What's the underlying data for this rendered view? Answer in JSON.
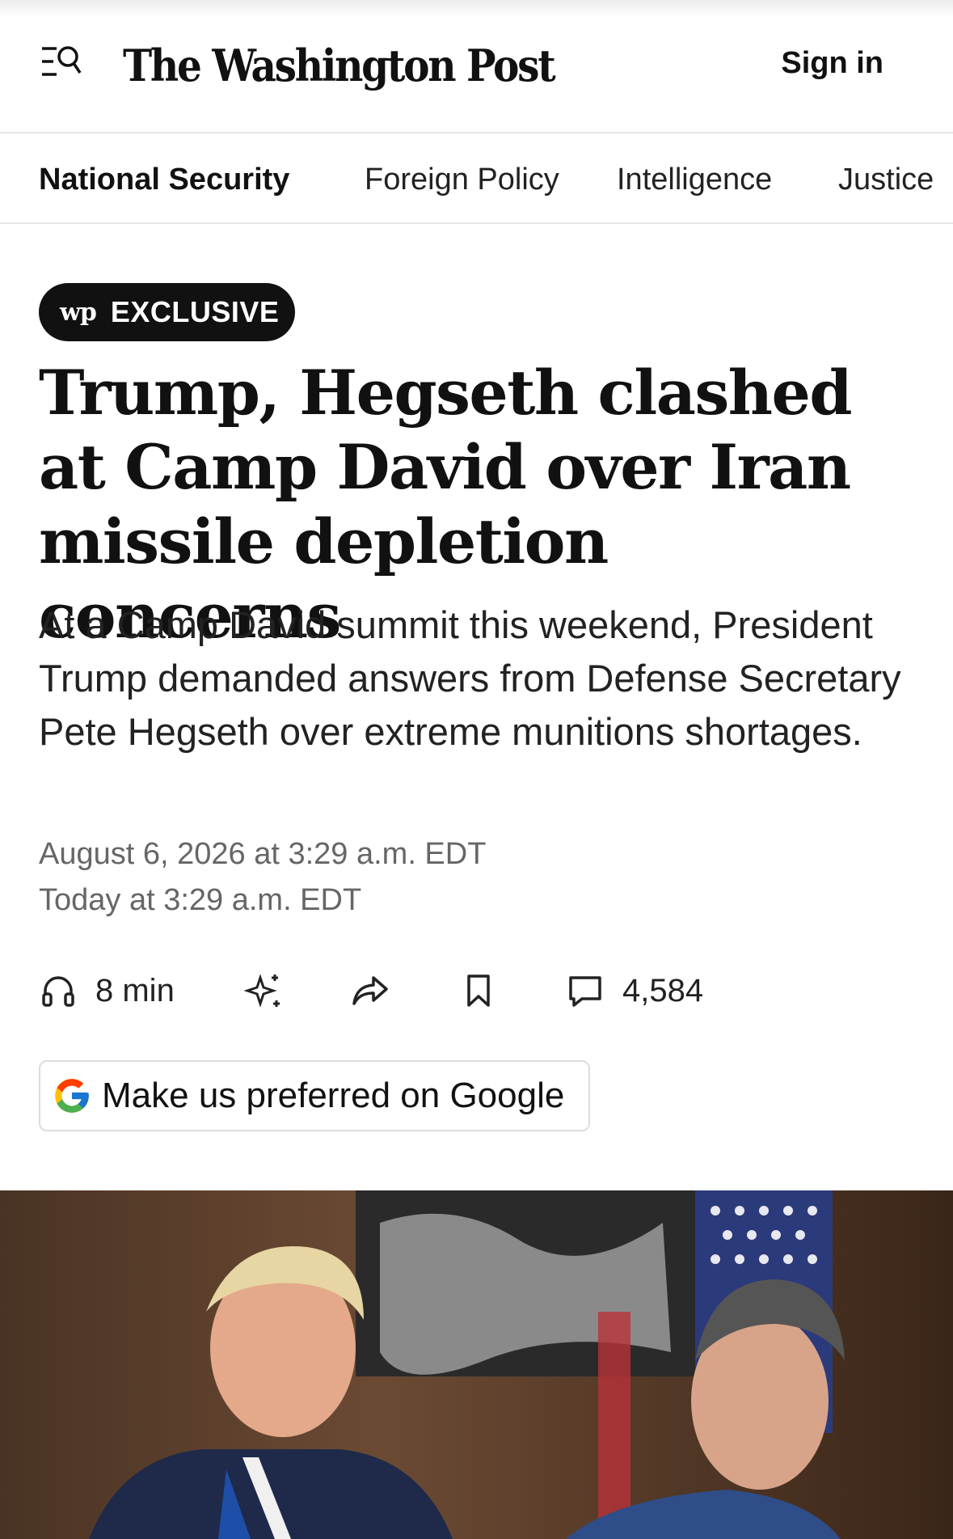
{
  "header": {
    "masthead": "The Washington Post",
    "sign_in": "Sign in"
  },
  "section_nav": {
    "items": [
      {
        "label": "National Security",
        "active": true
      },
      {
        "label": "Foreign Policy",
        "active": false
      },
      {
        "label": "Intelligence",
        "active": false
      },
      {
        "label": "Justice",
        "active": false
      }
    ]
  },
  "article": {
    "badge_logo": "wp",
    "badge_label": "EXCLUSIVE",
    "headline": "Trump, Hegseth clashed at Camp David over Iran missile depletion concerns",
    "dek": "At a Camp David summit this weekend, President Trump demanded answers from Defense Secretary Pete Hegseth over extreme munitions shortages.",
    "published": "August 6, 2026 at 3:29 a.m. EDT",
    "updated": "Today at 3:29 a.m. EDT"
  },
  "actions": {
    "listen_label": "8 min",
    "listen_icon": "headphones-icon",
    "ai_icon": "sparkle-icon",
    "share_icon": "share-icon",
    "save_icon": "bookmark-icon",
    "comments_icon": "comment-icon",
    "comments_count": "4,584"
  },
  "google_button": {
    "label": "Make us preferred on Google",
    "icon": "google-g-icon"
  },
  "colors": {
    "text": "#111111",
    "muted": "#666666",
    "badge_bg": "#111111",
    "divider": "#e6e6e6"
  }
}
